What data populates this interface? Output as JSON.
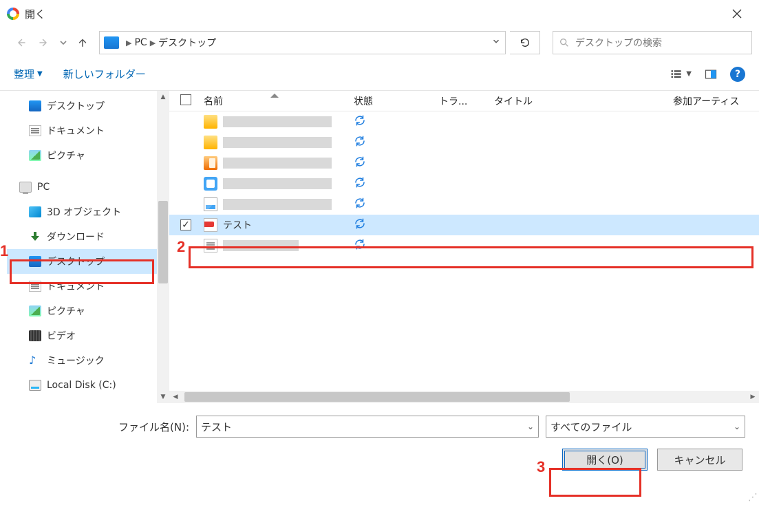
{
  "window": {
    "title": "開く"
  },
  "breadcrumb": {
    "pc": "PC",
    "location": "デスクトップ"
  },
  "search": {
    "placeholder": "デスクトップの検索"
  },
  "toolbar": {
    "organize": "整理",
    "newfolder": "新しいフォルダー"
  },
  "sidebar": {
    "quick": {
      "desktop": "デスクトップ",
      "documents": "ドキュメント",
      "pictures": "ピクチャ"
    },
    "pc_label": "PC",
    "pc": {
      "objects3d": "3D オブジェクト",
      "downloads": "ダウンロード",
      "desktop": "デスクトップ",
      "documents": "ドキュメント",
      "pictures": "ピクチャ",
      "videos": "ビデオ",
      "music": "ミュージック",
      "localdisk": "Local Disk (C:)"
    }
  },
  "columns": {
    "name": "名前",
    "status": "状態",
    "track": "トラ...",
    "title": "タイトル",
    "artist": "参加アーティス"
  },
  "files": {
    "selected_name": "テスト"
  },
  "footer": {
    "filename_label": "ファイル名(N):",
    "filename_value": "テスト",
    "filter_value": "すべてのファイル",
    "open_btn": "開く(O)",
    "cancel_btn": "キャンセル"
  },
  "annotations": {
    "n1": "1",
    "n2": "2",
    "n3": "3"
  }
}
